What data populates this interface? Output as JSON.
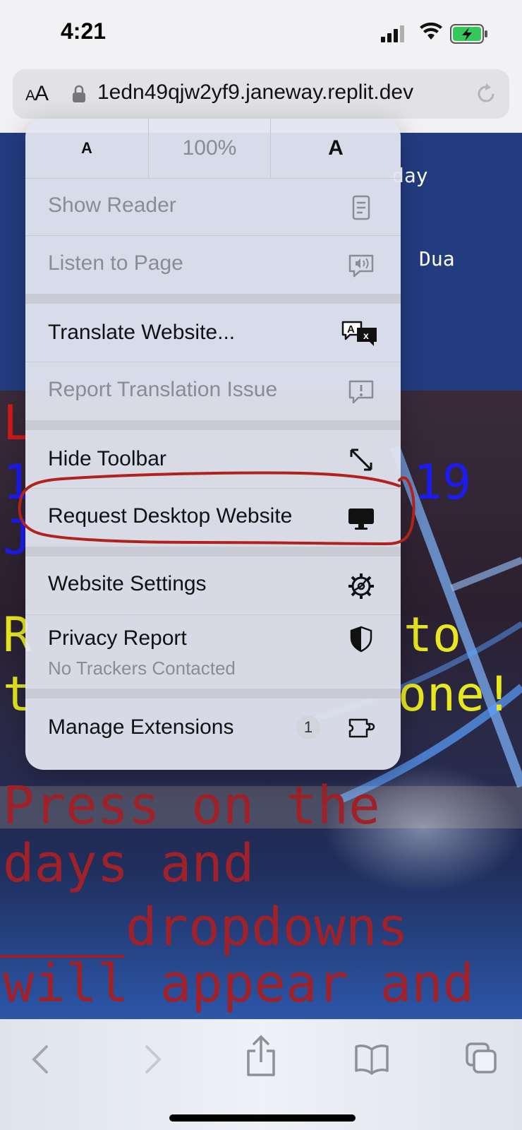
{
  "status_bar": {
    "time": "4:21"
  },
  "address_bar": {
    "format_label_small": "A",
    "format_label_big": "A",
    "url": "1edn49qjw2yf9.janeway.replit.dev"
  },
  "page": {
    "header_day": "day",
    "header_dua": "Dua",
    "overlay_text": {
      "l": "L",
      "one": "1",
      "nineteen": "19",
      "j": "J",
      "r": "R",
      "to": "to",
      "t": "t",
      "one_excl": "one!",
      "line1": "Press on the",
      "line2": "days and",
      "line3": "dropdowns",
      "line4": "will appear and"
    }
  },
  "menu": {
    "zoom": {
      "decrease_label": "A",
      "level": "100%",
      "increase_label": "A"
    },
    "items": {
      "show_reader": "Show Reader",
      "listen_to_page": "Listen to Page",
      "translate_website": "Translate Website...",
      "report_translation_issue": "Report Translation Issue",
      "hide_toolbar": "Hide Toolbar",
      "request_desktop_website": "Request Desktop Website",
      "website_settings": "Website Settings",
      "privacy_report": "Privacy Report",
      "privacy_report_subtitle": "No Trackers Contacted",
      "manage_extensions": "Manage Extensions",
      "manage_extensions_badge": "1"
    }
  },
  "toolbar": {
    "icons": [
      "back-icon",
      "forward-icon",
      "share-icon",
      "bookmarks-icon",
      "tabs-icon"
    ]
  },
  "colors": {
    "annotation": "#b0231d",
    "page_header": "#233c80",
    "battery": "#34c759"
  }
}
